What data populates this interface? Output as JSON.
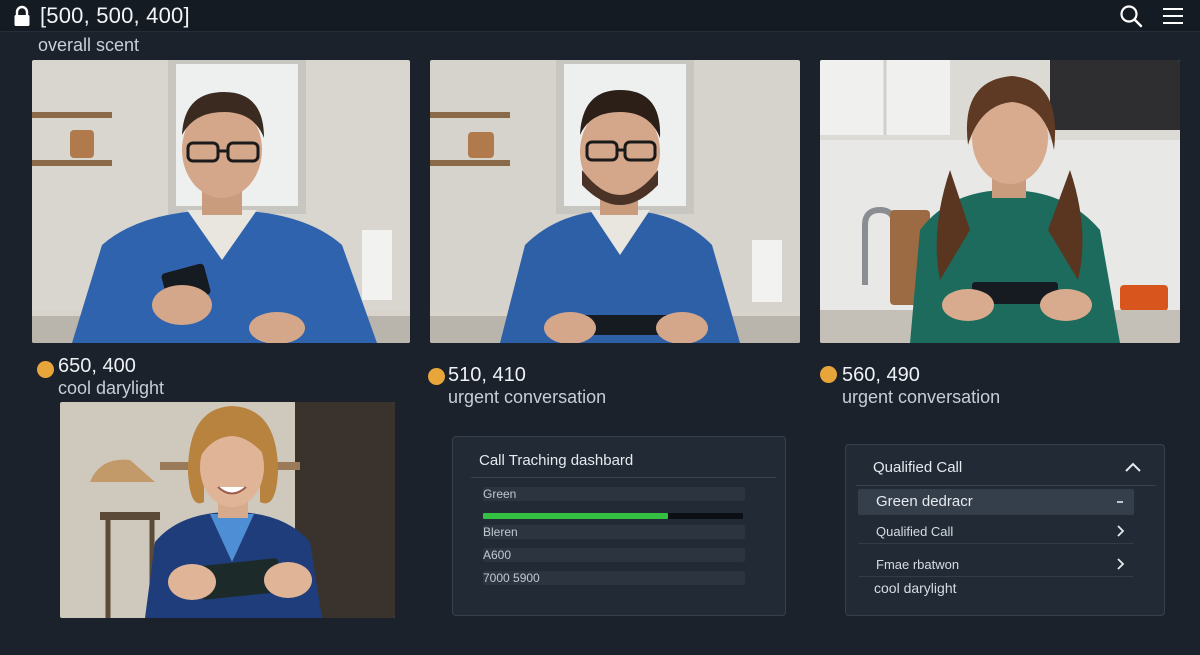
{
  "header": {
    "title": "[500, 500, 400]",
    "subtitle": "overall scent",
    "icons": [
      "lock-icon",
      "search-icon",
      "menu-icon"
    ]
  },
  "cards": [
    {
      "coords": "650, 400",
      "caption": "cool darylight"
    },
    {
      "coords": "510, 410",
      "caption": "urgent conversation"
    },
    {
      "coords": "560, 490",
      "caption": "urgent conversation"
    }
  ],
  "dashboard": {
    "title": "Call Traching dashbard",
    "rows": [
      {
        "label": "Green",
        "progress": 0.71
      },
      {
        "label": "Bleren"
      },
      {
        "label": "A600"
      },
      {
        "label": "7000 5900"
      }
    ]
  },
  "dropdown": {
    "title": "Qualified Call",
    "items": [
      {
        "label": "Green dedracr",
        "icon": "chevron-down-icon",
        "selected": true
      },
      {
        "label": "Qualified Call",
        "icon": "chevron-right-icon"
      },
      {
        "label": "Fmae rbatwon",
        "icon": "chevron-right-icon"
      }
    ],
    "footer": "cool darylight"
  },
  "colors": {
    "background": "#1b222c",
    "accent_dot": "#e8a53a",
    "progress_green": "#34c040"
  }
}
